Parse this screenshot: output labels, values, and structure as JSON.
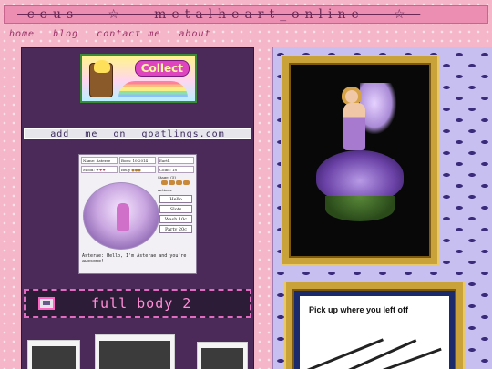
{
  "site": {
    "title": "-cous---☆---metalheart_online---☆-"
  },
  "nav": {
    "items": [
      {
        "label": "home"
      },
      {
        "label": "blog"
      },
      {
        "label": "contact me"
      },
      {
        "label": "about"
      }
    ]
  },
  "left": {
    "collect_banner": {
      "label": "Collect"
    },
    "add_me": "add me on goatlings.com",
    "goat_card": {
      "name_label": "Name:",
      "name_value": "Asterae",
      "born_label": "Born:",
      "born_value": "10-2014",
      "type_value": "Earth",
      "mood_label": "Mood:",
      "belly_label": "Belly",
      "coins_label": "Coins:",
      "coins_value": "18",
      "stage_label": "Stage: (5)",
      "actions_label": "Actions:",
      "actions": [
        "Hello",
        "Slots",
        "Wash 10c",
        "Party 20c"
      ],
      "speech": "Asterae: Hello, I'm Asterae and you're awesome!"
    },
    "fullbody": {
      "label": "full body 2"
    }
  },
  "right": {
    "sign": {
      "text": "Pick up where you left off"
    }
  },
  "colors": {
    "page_pink": "#f4b6c8",
    "title_bar": "#ec8eb2",
    "left_panel": "#4b2a5a",
    "fullbody_text": "#ff8fd6",
    "gold_frame": "#c9a23a"
  }
}
